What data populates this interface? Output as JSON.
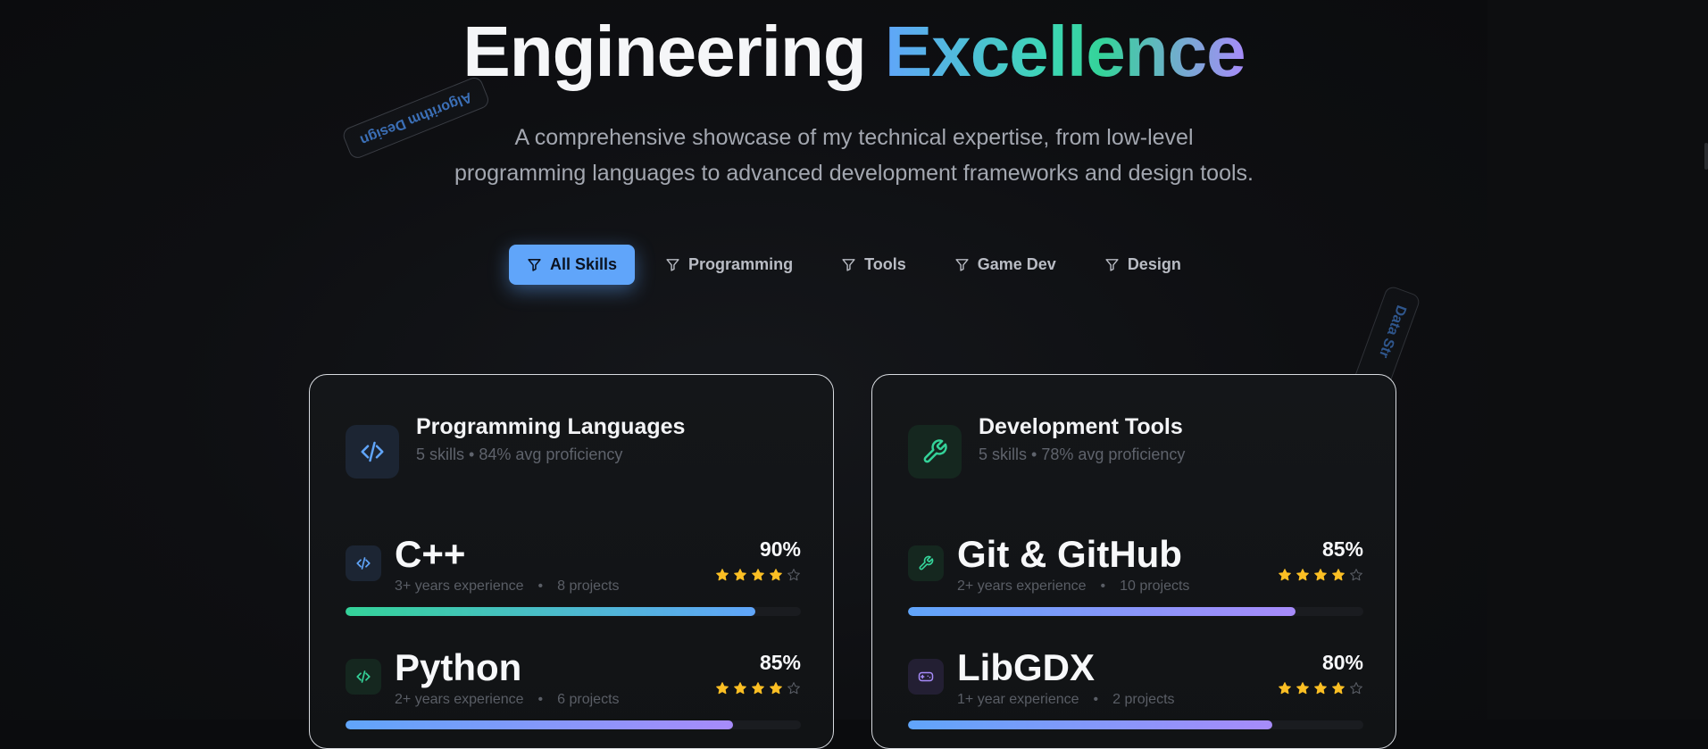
{
  "hero": {
    "title_main": "Engineering ",
    "title_accent": "Excellence",
    "subtitle_line1": "A comprehensive showcase of my technical expertise, from low-level",
    "subtitle_line2": "programming languages to advanced development frameworks and design tools."
  },
  "floating_tags": {
    "algorithm": "Algorithm Design",
    "data": "Data Str"
  },
  "filters": [
    {
      "label": "All Skills",
      "active": true
    },
    {
      "label": "Programming",
      "active": false
    },
    {
      "label": "Tools",
      "active": false
    },
    {
      "label": "Game Dev",
      "active": false
    },
    {
      "label": "Design",
      "active": false
    }
  ],
  "colors": {
    "accent_blue": "#60a5fa",
    "accent_green": "#34d399",
    "accent_purple": "#a78bfa",
    "star": "#fbbf24"
  },
  "cards": [
    {
      "title": "Programming Languages",
      "meta": "5 skills • 84% avg proficiency",
      "icon": "code-icon",
      "skills": [
        {
          "name": "C++",
          "experience": "3+ years experience",
          "projects": "8 projects",
          "percent_label": "90%",
          "proficiency": 0.9,
          "stars": 4,
          "icon": "code-icon"
        },
        {
          "name": "Python",
          "experience": "2+ years experience",
          "projects": "6 projects",
          "percent_label": "85%",
          "proficiency": 0.85,
          "stars": 4,
          "icon": "code-icon"
        }
      ]
    },
    {
      "title": "Development Tools",
      "meta": "5 skills • 78% avg proficiency",
      "icon": "wrench-icon",
      "skills": [
        {
          "name": "Git & GitHub",
          "experience": "2+ years experience",
          "projects": "10 projects",
          "percent_label": "85%",
          "proficiency": 0.85,
          "stars": 4,
          "icon": "wrench-icon"
        },
        {
          "name": "LibGDX",
          "experience": "1+ year experience",
          "projects": "2 projects",
          "percent_label": "80%",
          "proficiency": 0.8,
          "stars": 4,
          "icon": "gamepad-icon"
        }
      ]
    }
  ]
}
